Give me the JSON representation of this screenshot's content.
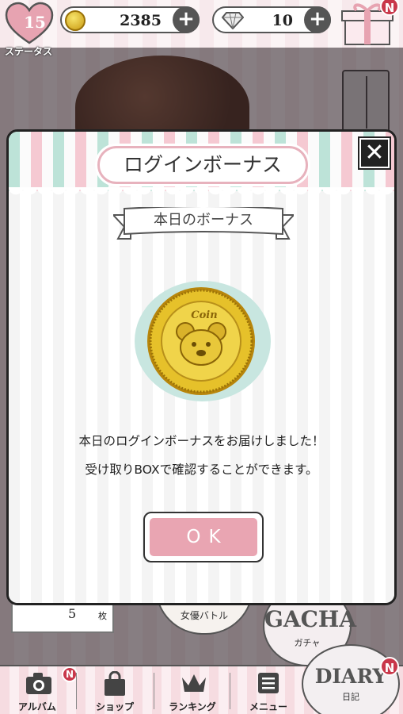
{
  "header": {
    "status_level": "15",
    "status_label": "ステータス",
    "coins": "2385",
    "diamonds": "10",
    "plus_symbol": "+",
    "gift_badge": "N"
  },
  "modal": {
    "title": "ログインボーナス",
    "close_symbol": "✕",
    "subtitle": "本日のボーナス",
    "coin_text": "Coin",
    "message_line1": "本日のログインボーナスをお届けしました！",
    "message_line2": "受け取りBOXで確認することができます。",
    "ok_label": "OK"
  },
  "background": {
    "ticket_count": "5",
    "ticket_unit": "枚",
    "battle_label": "女優バトル",
    "gacha_title": "GACHA",
    "gacha_sub": "ガチャ"
  },
  "bottom_nav": {
    "items": [
      {
        "label": "アルバム",
        "icon": "camera-icon",
        "badge": "N"
      },
      {
        "label": "ショップ",
        "icon": "shopping-bag-icon"
      },
      {
        "label": "ランキング",
        "icon": "crown-icon"
      },
      {
        "label": "メニュー",
        "icon": "menu-icon"
      }
    ],
    "diary_title": "DIARY",
    "diary_sub": "日記",
    "diary_badge": "N"
  },
  "colors": {
    "accent_pink": "#e9a5b2",
    "mint": "#bde3d8",
    "badge_red": "#c9374a",
    "coin_gold": "#d8b020"
  }
}
